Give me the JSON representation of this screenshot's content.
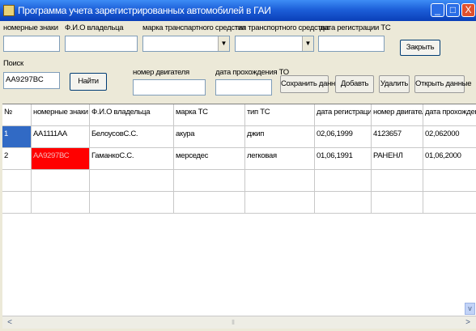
{
  "window": {
    "title": "Программа учета зарегистрированных автомобилей в ГАИ",
    "min_glyph": "_",
    "max_glyph": "□",
    "close_glyph": "X"
  },
  "form": {
    "plate_label": "номерные знаки",
    "owner_label": "Ф.И.О владельца",
    "brand_label": "марка транспартного средства",
    "type_label": "тип транспортного средства",
    "regdate_label": "дата регистрации ТС",
    "close_button": "Закрыть",
    "search_label": "Поиск",
    "search_value": "АА9297ВС",
    "find_button": "Найти",
    "engine_label": "номер двигателя",
    "inspection_label": "дата прохождения ТО",
    "save_button": "Сохранить данные",
    "add_button": "Добавть",
    "delete_button": "Удалить",
    "open_button": "Открыть данные",
    "dropdown_arrow": "▼"
  },
  "grid": {
    "headers": [
      "№",
      "номерные знаки",
      "Ф.И.О владельца",
      "марка ТС",
      "тип ТС",
      "дата регистрации",
      "номер двигателя",
      "дата прохождения"
    ],
    "rows": [
      [
        "1",
        "АА1111АА",
        "БелоусовС.С.",
        "акура",
        "джип",
        "02,06,1999",
        "4123657",
        "02,062000"
      ],
      [
        "2",
        "АА9297ВС",
        "ГаманкоС.С.",
        "мерседес",
        "легковая",
        "01,06,1991",
        "РАНЕНЛ",
        "01,06,2000"
      ]
    ]
  },
  "scroll": {
    "left_arrow": "<",
    "right_arrow": ">",
    "down_arrow": "v",
    "thumb_grip": "⦀"
  },
  "colors": {
    "selected_row_cell": "#316ac5",
    "highlight_cell": "#ff0000",
    "title_blue": "#1d5fd9"
  }
}
